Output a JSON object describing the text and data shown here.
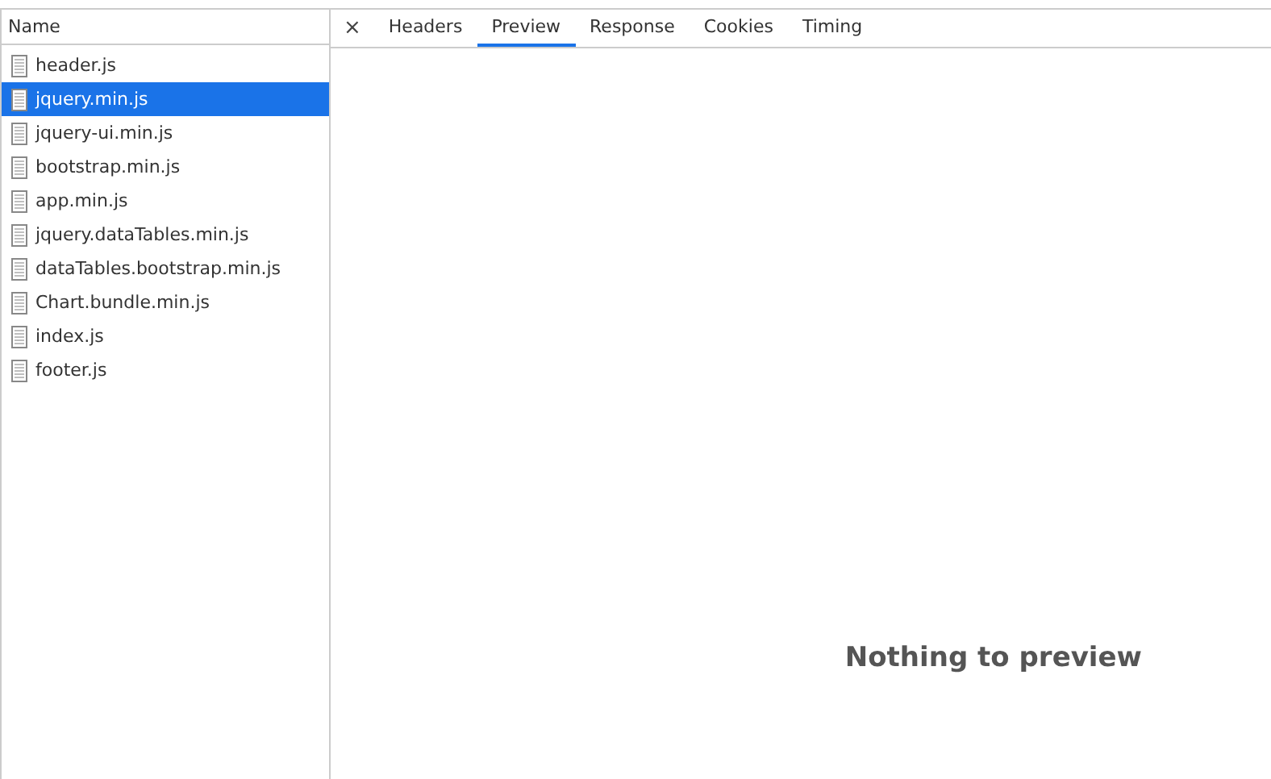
{
  "file_list": {
    "column_header": "Name",
    "files": [
      {
        "name": "header.js",
        "selected": false
      },
      {
        "name": "jquery.min.js",
        "selected": true
      },
      {
        "name": "jquery-ui.min.js",
        "selected": false
      },
      {
        "name": "bootstrap.min.js",
        "selected": false
      },
      {
        "name": "app.min.js",
        "selected": false
      },
      {
        "name": "jquery.dataTables.min.js",
        "selected": false
      },
      {
        "name": "dataTables.bootstrap.min.js",
        "selected": false
      },
      {
        "name": "Chart.bundle.min.js",
        "selected": false
      },
      {
        "name": "index.js",
        "selected": false
      },
      {
        "name": "footer.js",
        "selected": false
      }
    ]
  },
  "detail": {
    "close": "×",
    "tabs": [
      {
        "label": "Headers",
        "selected": false
      },
      {
        "label": "Preview",
        "selected": true
      },
      {
        "label": "Response",
        "selected": false
      },
      {
        "label": "Cookies",
        "selected": false
      },
      {
        "label": "Timing",
        "selected": false
      }
    ],
    "message": "Nothing to preview"
  }
}
